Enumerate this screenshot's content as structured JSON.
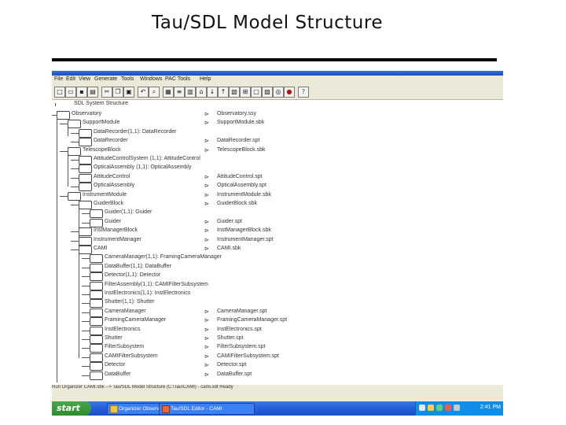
{
  "slide_title": "Tau/SDL Model Structure",
  "menu": [
    "File",
    "Edit",
    "View",
    "Generate",
    "Tools",
    "Windows",
    "PAC Tools",
    "Help"
  ],
  "toolbar_icons": [
    "new-icon",
    "open-icon",
    "save-icon",
    "print-icon",
    "cut-icon",
    "copy-icon",
    "paste-icon",
    "undo-icon",
    "find-icon",
    "grid-icon",
    "list-icon",
    "tree-icon",
    "home-icon",
    "arrow-down-icon",
    "arrow-up-icon",
    "map-icon",
    "diagram-icon",
    "window-icon",
    "image-icon",
    "target-icon",
    "stop-icon",
    "help-icon"
  ],
  "tree": {
    "root": "SDL System Structure",
    "rows": [
      {
        "label": "Observatory",
        "file": "Observatory.ssy",
        "mark": "⊳"
      },
      {
        "label": "SupportModule",
        "file": "SupportModule.sbk",
        "mark": "⊳"
      },
      {
        "label": "DataRecorder(1,1): DataRecorder",
        "file": "",
        "mark": ""
      },
      {
        "label": "DataRecorder",
        "file": "DataRecorder.spt",
        "mark": "⊳"
      },
      {
        "label": "TelescopeBlock",
        "file": "TelescopeBlock.sbk",
        "mark": "⊳"
      },
      {
        "label": "AttitudeControlSystem (1,1): AttitudeControl",
        "file": "",
        "mark": ""
      },
      {
        "label": "OpticalAssembly (1,1): OpticalAssembly",
        "file": "",
        "mark": ""
      },
      {
        "label": "AttitudeControl",
        "file": "AttitudeControl.spt",
        "mark": "⊳"
      },
      {
        "label": "OpticalAssembly",
        "file": "OpticalAssembly.spt",
        "mark": "⊳"
      },
      {
        "label": "InstrumentModule",
        "file": "InstrumentModule.sbk",
        "mark": "⊳"
      },
      {
        "label": "GuiderBlock",
        "file": "GuiderBlock.sbk",
        "mark": "⊳"
      },
      {
        "label": "Guider(1,1): Guider",
        "file": "",
        "mark": ""
      },
      {
        "label": "Guider",
        "file": "Guider.spt",
        "mark": "⊳"
      },
      {
        "label": "InstManagerBlock",
        "file": "InstManagerBlock.sbk",
        "mark": "⊳"
      },
      {
        "label": "InstrumentManager",
        "file": "InstrumentManager.spt",
        "mark": "⊳"
      },
      {
        "label": "CAMI",
        "file": "CAMI.sbk",
        "mark": "⊳"
      },
      {
        "label": "CameraManager(1,1): FramingCameraManager",
        "file": "",
        "mark": ""
      },
      {
        "label": "DataBuffer(1,1): DataBuffer",
        "file": "",
        "mark": ""
      },
      {
        "label": "Detector(1,1): Detector",
        "file": "",
        "mark": ""
      },
      {
        "label": "FilterAssembly(1,1): CAMIFilterSubsystem",
        "file": "",
        "mark": ""
      },
      {
        "label": "InstElectronics(1,1): InstElectronics",
        "file": "",
        "mark": ""
      },
      {
        "label": "Shutter(1,1): Shutter",
        "file": "",
        "mark": ""
      },
      {
        "label": "CameraManager",
        "file": "CameraManager.spt",
        "mark": "⊳"
      },
      {
        "label": "FramingCameraManager",
        "file": "FramingCameraManager.spt",
        "mark": "⊳"
      },
      {
        "label": "InstElectronics",
        "file": "InstElectronics.spt",
        "mark": "⊳"
      },
      {
        "label": "Shutter",
        "file": "Shutter.spt",
        "mark": "⊳"
      },
      {
        "label": "FilterSubsystem",
        "file": "FilterSubsystem.spt",
        "mark": "⊳"
      },
      {
        "label": "CAMIFilterSubsystem",
        "file": "CAMIFilterSubsystem.spt",
        "mark": "⊳"
      },
      {
        "label": "Detector",
        "file": "Detector.spt",
        "mark": "⊳"
      },
      {
        "label": "DataBuffer",
        "file": "DataBuffer.spt",
        "mark": "⊳"
      }
    ]
  },
  "status_text": "Run Organizer  CAMI.sbk  -->  Tau/SDL Model Structure  (C:\\Tau\\CAMI) - cami.sdt  Ready",
  "taskbar": {
    "start": "start",
    "tasks": [
      "Organizer Observatory",
      "Tau/SDL Editor - CAMI"
    ],
    "clock": "2:41 PM"
  },
  "colors": {
    "window_chrome": "#ece9d8",
    "taskbar": "#245edb",
    "start_button": "#2f8a2f"
  }
}
